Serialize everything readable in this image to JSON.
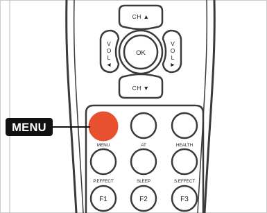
{
  "dpad": {
    "ch_up": "CH ▲",
    "ch_down": "CH ▼",
    "vol_left": [
      "V",
      "O",
      "L",
      "◄"
    ],
    "vol_right": [
      "V",
      "O",
      "L",
      "►"
    ],
    "ok": "OK"
  },
  "keypad": {
    "rows": [
      [
        "MENU",
        "AT",
        "HEALTH"
      ],
      [
        "P.EFFECT",
        "SLEEP",
        "S.EFFECT"
      ],
      [
        "F1",
        "F2",
        "F3"
      ]
    ]
  },
  "callout": {
    "label": "MENU"
  },
  "colors": {
    "highlight": "#e75130",
    "stroke": "#3a3a3a",
    "body": "#ffffff",
    "callout_bg": "#111111"
  }
}
